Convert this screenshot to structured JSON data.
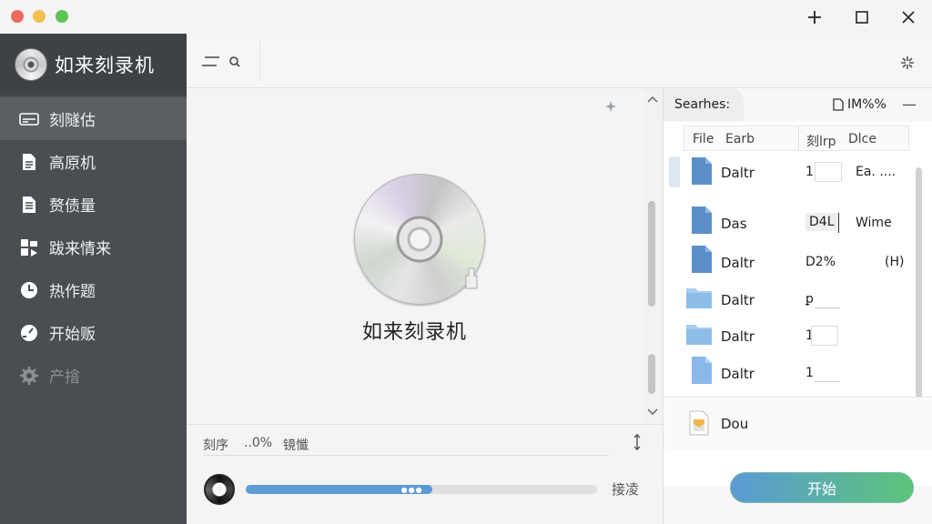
{
  "window": {
    "controls": {
      "add": "+",
      "maximize": "□",
      "close": "✕"
    }
  },
  "app": {
    "title": "如来刻录机"
  },
  "sidebar": {
    "items": [
      {
        "label": "刻隧估",
        "icon": "disc-drive-icon",
        "active": true,
        "disabled": false
      },
      {
        "label": "高原机",
        "icon": "document-icon",
        "active": false,
        "disabled": false
      },
      {
        "label": "赘债量",
        "icon": "document-lines-icon",
        "active": false,
        "disabled": false
      },
      {
        "label": "跋来情来",
        "icon": "puzzle-icon",
        "active": false,
        "disabled": false
      },
      {
        "label": "热作题",
        "icon": "clock-icon",
        "active": false,
        "disabled": false
      },
      {
        "label": "开始贩",
        "icon": "gauge-icon",
        "active": false,
        "disabled": false
      },
      {
        "label": "产摿",
        "icon": "gear-icon",
        "active": false,
        "disabled": true
      }
    ]
  },
  "center": {
    "title": "如来刻录机"
  },
  "status": {
    "label": "刻序",
    "percent": "..0%",
    "state": "镜懺"
  },
  "progress": {
    "fraction": 0.53,
    "label": "接凌"
  },
  "right_panel": {
    "tab_label": "Searhes:",
    "percent_label": "IM%%",
    "columns": [
      "File",
      "Earb",
      "刻lrp",
      "Dlce"
    ],
    "rows": [
      {
        "name": "Daltr",
        "size": "1",
        "type": "Ea. ....",
        "icon": "file-blue-icon"
      },
      {
        "name": "Das",
        "size": "D4L",
        "type": "Wime",
        "icon": "file-blue-icon"
      },
      {
        "name": "Daltr",
        "size": "D2%",
        "type": "(H)",
        "icon": "file-blue-icon"
      },
      {
        "name": "Daltr",
        "size": "ꝑ",
        "type": "",
        "icon": "folder-icon"
      },
      {
        "name": "Daltr",
        "size": "1",
        "type": "",
        "icon": "folder-icon"
      },
      {
        "name": "Daltr",
        "size": "1",
        "type": "",
        "icon": "file-light-blue-icon"
      }
    ],
    "extra_item": {
      "name": "Dou",
      "icon": "archive-icon"
    },
    "start_button": "开始"
  },
  "colors": {
    "sidebar": "#4a4d52",
    "accent_blue": "#5b9ad6",
    "accent_green": "#5cc47a"
  }
}
